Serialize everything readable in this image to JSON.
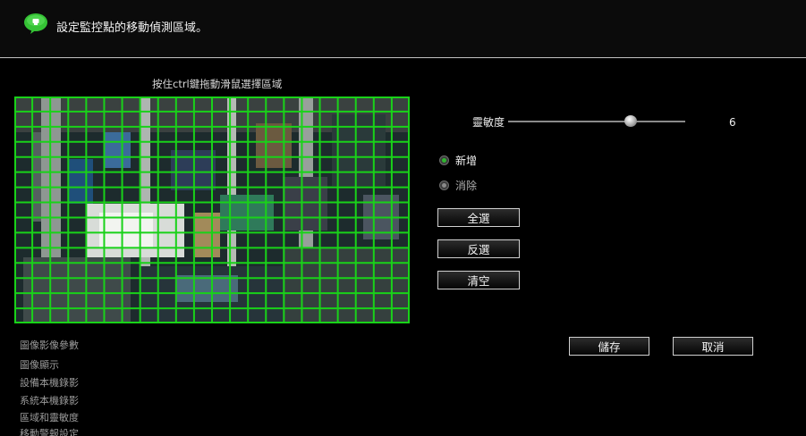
{
  "header": {
    "title": "設定監控點的移動偵測區域。",
    "icon": "chat-bubble-icon",
    "accent_color": "#2fb52f"
  },
  "instruction": "按住ctrl鍵拖動滑鼠選擇區域",
  "detection_grid": {
    "columns": 22,
    "rows": 15,
    "line_color": "#19d219",
    "all_cells_selected": true
  },
  "sensitivity": {
    "label": "靈敏度",
    "value": "6",
    "level_fraction": 0.69
  },
  "mode": {
    "options": [
      {
        "label": "新增",
        "selected": true
      },
      {
        "label": "消除",
        "selected": false
      }
    ]
  },
  "buttons": {
    "select_all": "全選",
    "invert": "反選",
    "clear": "清空",
    "save": "儲存",
    "cancel": "取消"
  },
  "menu": {
    "items": [
      "圖像影像參數",
      "圖像顯示",
      "設備本機錄影",
      "系統本機錄影",
      "區域和靈敏度",
      "移動警報設定"
    ]
  }
}
